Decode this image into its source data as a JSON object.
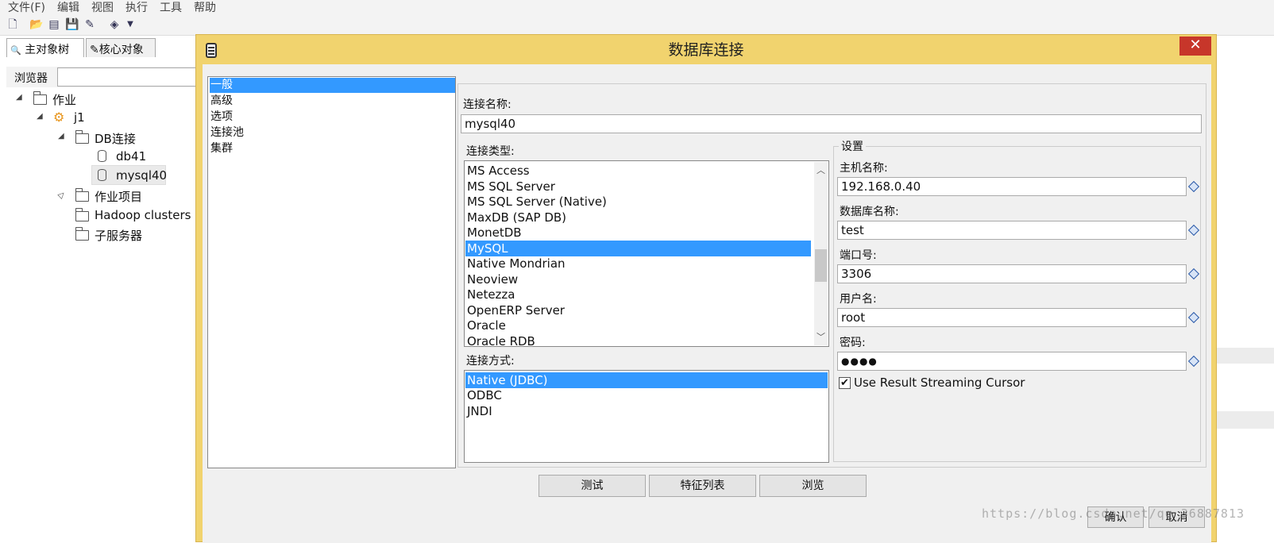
{
  "menu": [
    "文件(F)",
    "编辑",
    "视图",
    "执行",
    "工具",
    "帮助"
  ],
  "toolbar_icons": [
    "new-file-icon",
    "open-folder-icon",
    "explore-icon",
    "save-icon",
    "save-as-icon",
    "layers-icon",
    "dropdown-arrow-icon"
  ],
  "left_tabs": [
    "主对象树",
    "核心对象"
  ],
  "browser_label": "浏览器",
  "tree": {
    "jobs": "作业",
    "j1": "j1",
    "db_conn": "DB连接",
    "db41": "db41",
    "mysql40": "mysql40",
    "job_items": "作业项目",
    "hadoop": "Hadoop clusters",
    "subservers": "子服务器"
  },
  "dialog": {
    "title": "数据库连接",
    "close": "✕",
    "nav": [
      "一般",
      "高级",
      "选项",
      "连接池",
      "集群"
    ],
    "nav_selected": 0,
    "conn_name_label": "连接名称:",
    "conn_name_value": "mysql40",
    "conn_type_label": "连接类型:",
    "conn_types": [
      "MS Access",
      "MS SQL Server",
      "MS SQL Server (Native)",
      "MaxDB (SAP DB)",
      "MonetDB",
      "MySQL",
      "Native Mondrian",
      "Neoview",
      "Netezza",
      "OpenERP Server",
      "Oracle",
      "Oracle RDB"
    ],
    "conn_type_selected": "MySQL",
    "access_label": "连接方式:",
    "access_methods": [
      "Native (JDBC)",
      "ODBC",
      "JNDI"
    ],
    "access_selected": "Native (JDBC)",
    "settings_title": "设置",
    "host_label": "主机名称:",
    "host_value": "192.168.0.40",
    "dbname_label": "数据库名称:",
    "dbname_value": "test",
    "port_label": "端口号:",
    "port_value": "3306",
    "user_label": "用户名:",
    "user_value": "root",
    "password_label": "密码:",
    "password_value": "●●●●",
    "streaming_label": "Use Result Streaming Cursor",
    "streaming_checked": true,
    "buttons": {
      "test": "测试",
      "features": "特征列表",
      "browse": "浏览",
      "ok": "确认",
      "cancel": "取消"
    }
  },
  "watermark": "https://blog.csdn.net/qq_36887813"
}
